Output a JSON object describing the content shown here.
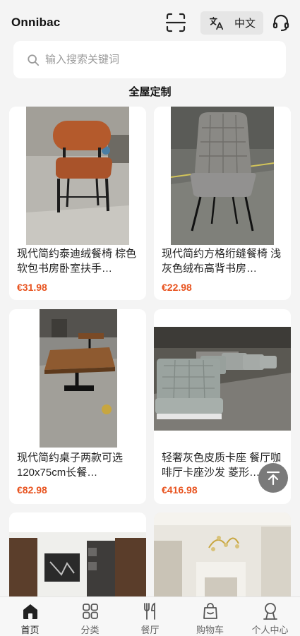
{
  "header": {
    "brand": "Onnibac",
    "language_label": "中文"
  },
  "search": {
    "placeholder": "输入搜索关键词"
  },
  "section_title": "全屋定制",
  "products": [
    {
      "name": "现代简约泰迪绒餐椅 棕色软包书房卧室扶手…",
      "price": "€31.98"
    },
    {
      "name": "现代简约方格绗缝餐椅 浅灰色绒布高背书房…",
      "price": "€22.98"
    },
    {
      "name": "现代简约桌子两款可选 120x75cm长餐…",
      "price": "€82.98"
    },
    {
      "name": "轻奢灰色皮质卡座 餐厅咖啡厅卡座沙发 菱形…",
      "price": "€416.98"
    }
  ],
  "tabbar": [
    {
      "label": "首页",
      "icon": "home-icon",
      "active": true
    },
    {
      "label": "分类",
      "icon": "grid-icon",
      "active": false
    },
    {
      "label": "餐厅",
      "icon": "fork-knife-icon",
      "active": false
    },
    {
      "label": "购物车",
      "icon": "bag-icon",
      "active": false
    },
    {
      "label": "个人中心",
      "icon": "user-icon",
      "active": false
    }
  ],
  "colors": {
    "price": "#e8531f",
    "background": "#f4f4f4",
    "card": "#ffffff"
  }
}
